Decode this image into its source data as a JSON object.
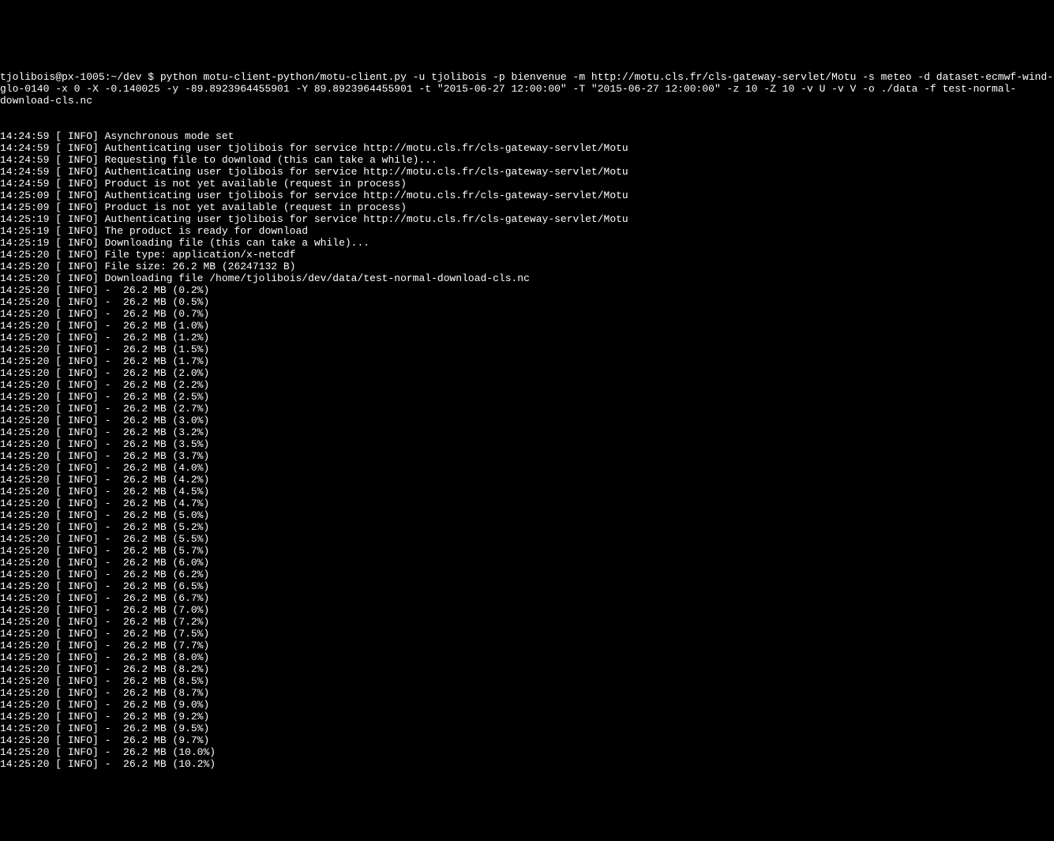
{
  "prompt_cut": "tjolibois@px-1005:~/dev $ ",
  "command": "python motu-client-python/motu-client.py -u tjolibois -p bienvenue -m http://motu.cls.fr/cls-gateway-servlet/Motu -s meteo -d dataset-ecmwf-wind-glo-0140 -x 0 -X -0.140025 -y -89.8923964455901 -Y 89.8923964455901 -t \"2015-06-27 12:00:00\" -T \"2015-06-27 12:00:00\" -z 10 -Z 10 -v U -v V -o ./data -f test-normal-download-cls.nc",
  "info_lines": [
    {
      "ts": "14:24:59",
      "msg": "Asynchronous mode set"
    },
    {
      "ts": "14:24:59",
      "msg": "Authenticating user tjolibois for service http://motu.cls.fr/cls-gateway-servlet/Motu"
    },
    {
      "ts": "14:24:59",
      "msg": "Requesting file to download (this can take a while)..."
    },
    {
      "ts": "14:24:59",
      "msg": "Authenticating user tjolibois for service http://motu.cls.fr/cls-gateway-servlet/Motu"
    },
    {
      "ts": "14:24:59",
      "msg": "Product is not yet available (request in process)"
    },
    {
      "ts": "14:25:09",
      "msg": "Authenticating user tjolibois for service http://motu.cls.fr/cls-gateway-servlet/Motu"
    },
    {
      "ts": "14:25:09",
      "msg": "Product is not yet available (request in process)"
    },
    {
      "ts": "14:25:19",
      "msg": "Authenticating user tjolibois for service http://motu.cls.fr/cls-gateway-servlet/Motu"
    },
    {
      "ts": "14:25:19",
      "msg": "The product is ready for download"
    },
    {
      "ts": "14:25:19",
      "msg": "Downloading file (this can take a while)..."
    },
    {
      "ts": "14:25:20",
      "msg": "File type: application/x-netcdf"
    },
    {
      "ts": "14:25:20",
      "msg": "File size: 26.2 MB (26247132 B)"
    },
    {
      "ts": "14:25:20",
      "msg": "Downloading file /home/tjolibois/dev/data/test-normal-download-cls.nc"
    }
  ],
  "progress_ts": "14:25:20",
  "progress_size": "26.2 MB",
  "progress_percents": [
    "0.2%",
    "0.5%",
    "0.7%",
    "1.0%",
    "1.2%",
    "1.5%",
    "1.7%",
    "2.0%",
    "2.2%",
    "2.5%",
    "2.7%",
    "3.0%",
    "3.2%",
    "3.5%",
    "3.7%",
    "4.0%",
    "4.2%",
    "4.5%",
    "4.7%",
    "5.0%",
    "5.2%",
    "5.5%",
    "5.7%",
    "6.0%",
    "6.2%",
    "6.5%",
    "6.7%",
    "7.0%",
    "7.2%",
    "7.5%",
    "7.7%",
    "8.0%",
    "8.2%",
    "8.5%",
    "8.7%",
    "9.0%",
    "9.2%",
    "9.5%",
    "9.7%",
    "10.0%",
    "10.2%"
  ]
}
